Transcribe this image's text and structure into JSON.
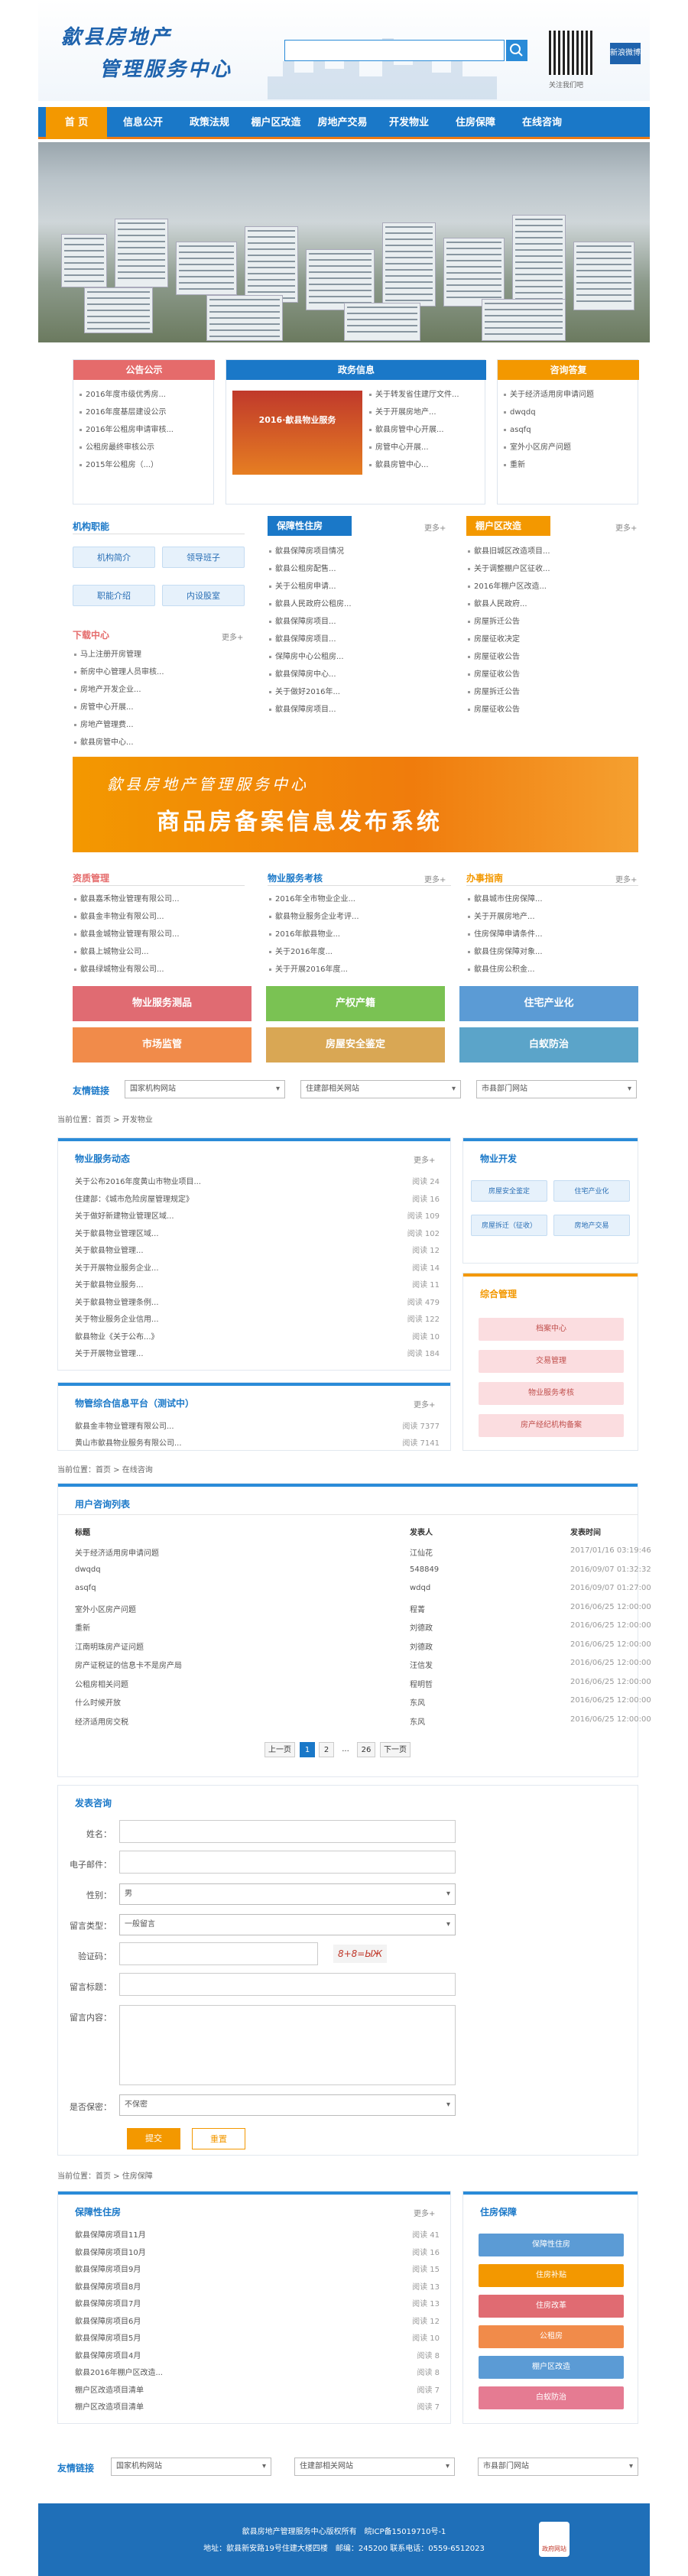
{
  "header": {
    "logo_line1": "歙县房地产",
    "logo_line2": "管理服务中心",
    "search_placeholder": "",
    "qr_label": "关注我们吧",
    "weibo": "新浪微博"
  },
  "nav": [
    "首 页",
    "信息公开",
    "政策法规",
    "棚户区改造",
    "房地产交易",
    "开发物业",
    "住房保障",
    "在线咨询"
  ],
  "top_boxes": {
    "notice": {
      "title": "公告公示",
      "items": [
        "2016年度市级优秀房...",
        "2016年度基层建设公示",
        "2016年公租房申请审核...",
        "公租房最终审核公示",
        "2015年公租房（...）"
      ]
    },
    "news": {
      "title": "政务信息",
      "banner_text": "2016·歙县物业服务",
      "items": [
        "关于转发省住建厅文件...",
        "关于开展房地产...",
        "歙县房管中心开展...",
        "房管中心开展...",
        "歙县房管中心..."
      ]
    },
    "consult": {
      "title": "咨询答复",
      "items": [
        "关于经济适用房申请问题",
        "dwqdq",
        "asqfq",
        "室外小区房产问题",
        "重新"
      ]
    }
  },
  "org": {
    "title": "机构职能",
    "buttons": [
      "机构简介",
      "领导班子",
      "职能介绍",
      "内设股室"
    ]
  },
  "download": {
    "title": "下载中心",
    "more": "更多+",
    "items": [
      "马上注册开房管理",
      "新房中心管理人员审核...",
      "房地产开发企业...",
      "房管中心开展...",
      "房地产管理费...",
      "歙县房管中心..."
    ]
  },
  "housing": {
    "title": "保障性住房",
    "more": "更多+",
    "items": [
      "歙县保障房项目情况",
      "歙县公租房配售...",
      "关于公租房申请...",
      "歙县人民政府公租房...",
      "歙县保障房项目...",
      "歙县保障房项目...",
      "保障房中心公租房...",
      "歙县保障房中心...",
      "关于做好2016年...",
      "歙县保障房项目..."
    ]
  },
  "shanty": {
    "title": "棚户区改造",
    "more": "更多+",
    "items": [
      "歙县旧城区改造项目...",
      "关于调整棚户区征收...",
      "2016年棚户区改造...",
      "歙县人民政府...",
      "房屋拆迁公告",
      "房屋征收决定",
      "房屋征收公告",
      "房屋征收公告",
      "房屋拆迁公告",
      "房屋征收公告"
    ]
  },
  "mid_banner": {
    "line1": "歙县房地产管理服务中心",
    "line2": "商品房备案信息发布系统"
  },
  "credit": {
    "title": "资质管理",
    "items": [
      "歙县嘉禾物业管理有限公司...",
      "歙县金丰物业有限公司...",
      "歙县金城物业管理有限公司...",
      "歙县上城物业公司...",
      "歙县绿城物业有限公司..."
    ]
  },
  "property_assess": {
    "title": "物业服务考核",
    "more": "更多+",
    "items": [
      "2016年全市物业企业...",
      "歙县物业服务企业考评...",
      "2016年歙县物业...",
      "关于2016年度...",
      "关于开展2016年度..."
    ]
  },
  "guide": {
    "title": "办事指南",
    "more": "更多+",
    "items": [
      "歙县城市住房保障...",
      "关于开展房地产...",
      "住房保障申请条件...",
      "歙县住房保障对象...",
      "歙县住房公积金..."
    ]
  },
  "big_buttons": [
    "物业服务测品",
    "产权产籍",
    "住宅产业化",
    "市场监管",
    "房屋安全鉴定",
    "白蚁防治"
  ],
  "links": {
    "title": "友情链接",
    "options": [
      "国家机构网站",
      "住建部相关网站",
      "市县部门网站"
    ]
  },
  "breadcrumb1": "当前位置：首页 > 开发物业",
  "property_news": {
    "title": "物业服务动态",
    "more": "更多+",
    "rows": [
      {
        "t": "关于公布2016年度黄山市物业项目...",
        "n": "阅读 24"
      },
      {
        "t": "住建部：《城市危险房屋管理规定》",
        "n": "阅读 16"
      },
      {
        "t": "关于做好新建物业管理区域...",
        "n": "阅读 109"
      },
      {
        "t": "关于歙县物业管理区域...",
        "n": "阅读 102"
      },
      {
        "t": "关于歙县物业管理...",
        "n": "阅读 12"
      },
      {
        "t": "关于开展物业服务企业...",
        "n": "阅读 14"
      },
      {
        "t": "关于歙县物业服务...",
        "n": "阅读 11"
      },
      {
        "t": "关于歙县物业管理条例...",
        "n": "阅读 479"
      },
      {
        "t": "关于物业服务企业信用...",
        "n": "阅读 122"
      },
      {
        "t": "歙县物业《关于公布...》",
        "n": "阅读 10"
      },
      {
        "t": "关于开展物业管理...",
        "n": "阅读 184"
      }
    ]
  },
  "property_platform": {
    "title": "物管综合信息平台（测试中）",
    "more": "更多+",
    "rows": [
      {
        "t": "歙县金丰物业管理有限公司...",
        "n": "阅读 7377"
      },
      {
        "t": "黄山市歙县物业服务有限公司...",
        "n": "阅读 7141"
      }
    ]
  },
  "dev": {
    "title": "物业开发",
    "buttons": [
      "房屋安全鉴定",
      "住宅产业化",
      "房屋拆迁（征收）",
      "房地产交易"
    ]
  },
  "manage": {
    "title": "综合管理",
    "buttons": [
      "档案中心",
      "交易管理",
      "物业服务考核",
      "房产经纪机构备案"
    ]
  },
  "breadcrumb2": "当前位置：首页 > 在线咨询",
  "consult_list": {
    "title": "用户咨询列表",
    "headers": [
      "标题",
      "发表人",
      "发表时间"
    ],
    "rows": [
      [
        "关于经济适用房申请问题",
        "江仙花",
        "2017/01/16 03:19:46"
      ],
      [
        "dwqdq",
        "548849",
        "2016/09/07 01:32:32"
      ],
      [
        "asqfq",
        "wdqd",
        "2016/09/07 01:27:00"
      ],
      [
        "室外小区房产问题",
        "程菁",
        "2016/06/25 12:00:00"
      ],
      [
        "重新",
        "刘德政",
        "2016/06/25 12:00:00"
      ],
      [
        "江南明珠房产证问题",
        "刘德政",
        "2016/06/25 12:00:00"
      ],
      [
        "房产证税证的信息卡不是房产局",
        "汪信发",
        "2016/06/25 12:00:00"
      ],
      [
        "公租房相关问题",
        "程明哲",
        "2016/06/25 12:00:00"
      ],
      [
        "什么时候开放",
        "东风",
        "2016/06/25 12:00:00"
      ],
      [
        "经济适用房交税",
        "东风",
        "2016/06/25 12:00:00"
      ]
    ],
    "pager": [
      "上一页",
      "1",
      "2",
      "...",
      "26",
      "下一页"
    ]
  },
  "form": {
    "title": "发表咨询",
    "labels": [
      "姓名：",
      "电子邮件：",
      "性别：",
      "留言类型：",
      "验证码：",
      "留言标题：",
      "留言内容：",
      "是否保密："
    ],
    "gender": "男",
    "type": "一般留言",
    "captcha": "8+8=ЫЖ",
    "secret": "不保密",
    "submit": "提交",
    "reset": "重置"
  },
  "breadcrumb3": "当前位置：首页 > 住房保障",
  "security_housing": {
    "title": "保障性住房",
    "more": "更多+",
    "rows": [
      {
        "t": "歙县保障房项目11月",
        "n": "阅读 41"
      },
      {
        "t": "歙县保障房项目10月",
        "n": "阅读 16"
      },
      {
        "t": "歙县保障房项目9月",
        "n": "阅读 15"
      },
      {
        "t": "歙县保障房项目8月",
        "n": "阅读 13"
      },
      {
        "t": "歙县保障房项目7月",
        "n": "阅读 13"
      },
      {
        "t": "歙县保障房项目6月",
        "n": "阅读 12"
      },
      {
        "t": "歙县保障房项目5月",
        "n": "阅读 10"
      },
      {
        "t": "歙县保障房项目4月",
        "n": "阅读 8"
      },
      {
        "t": "歙县2016年棚户区改造...",
        "n": "阅读 8"
      },
      {
        "t": "棚户区改造项目清单",
        "n": "阅读 7"
      },
      {
        "t": "棚户区改造项目清单",
        "n": "阅读 7"
      }
    ]
  },
  "housing_side": {
    "title": "住房保障",
    "buttons": [
      "保障性住房",
      "住房补贴",
      "住房改革",
      "公租房",
      "棚户区改造",
      "白蚁防治"
    ]
  },
  "links2": {
    "title": "友情链接",
    "options": [
      "国家机构网站",
      "住建部相关网站",
      "市县部门网站"
    ]
  },
  "footer": {
    "line1": "歙县房地产管理服务中心版权所有　皖ICP备15019710号-1",
    "line2": "地址：歙县新安路19号住建大楼四楼　邮编：245200 联系电话：0559-6512023",
    "badge": "政府网站"
  },
  "colors": {
    "primary": "#1a78c8",
    "accent": "#f39800"
  }
}
